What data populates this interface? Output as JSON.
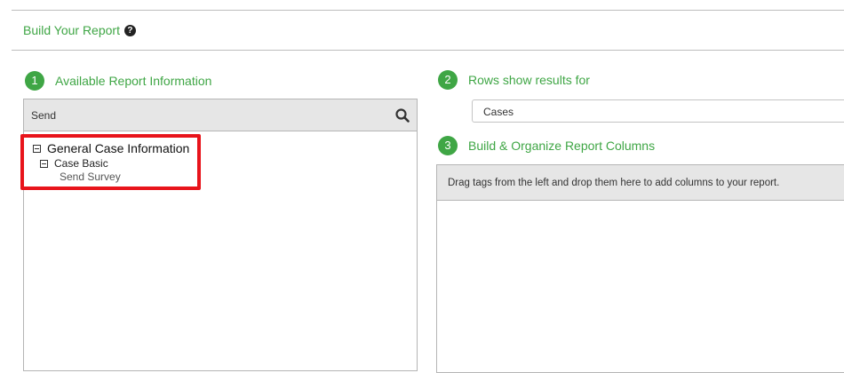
{
  "header": {
    "title": "Build Your Report",
    "help_icon": "question-circle-icon"
  },
  "steps": [
    {
      "number": "1",
      "label": "Available Report Information"
    },
    {
      "number": "2",
      "label": "Rows show results for"
    },
    {
      "number": "3",
      "label": "Build & Organize Report Columns"
    }
  ],
  "search": {
    "value": "Send",
    "icon": "search-icon"
  },
  "tree": {
    "group": "General Case Information",
    "subgroup": "Case Basic",
    "item": "Send Survey"
  },
  "rows_select": {
    "value": "Cases"
  },
  "columns": {
    "hint": "Drag tags from the left and drop them here to add columns to your report."
  },
  "colors": {
    "accent": "#3fa645",
    "highlight": "#e8141b"
  }
}
